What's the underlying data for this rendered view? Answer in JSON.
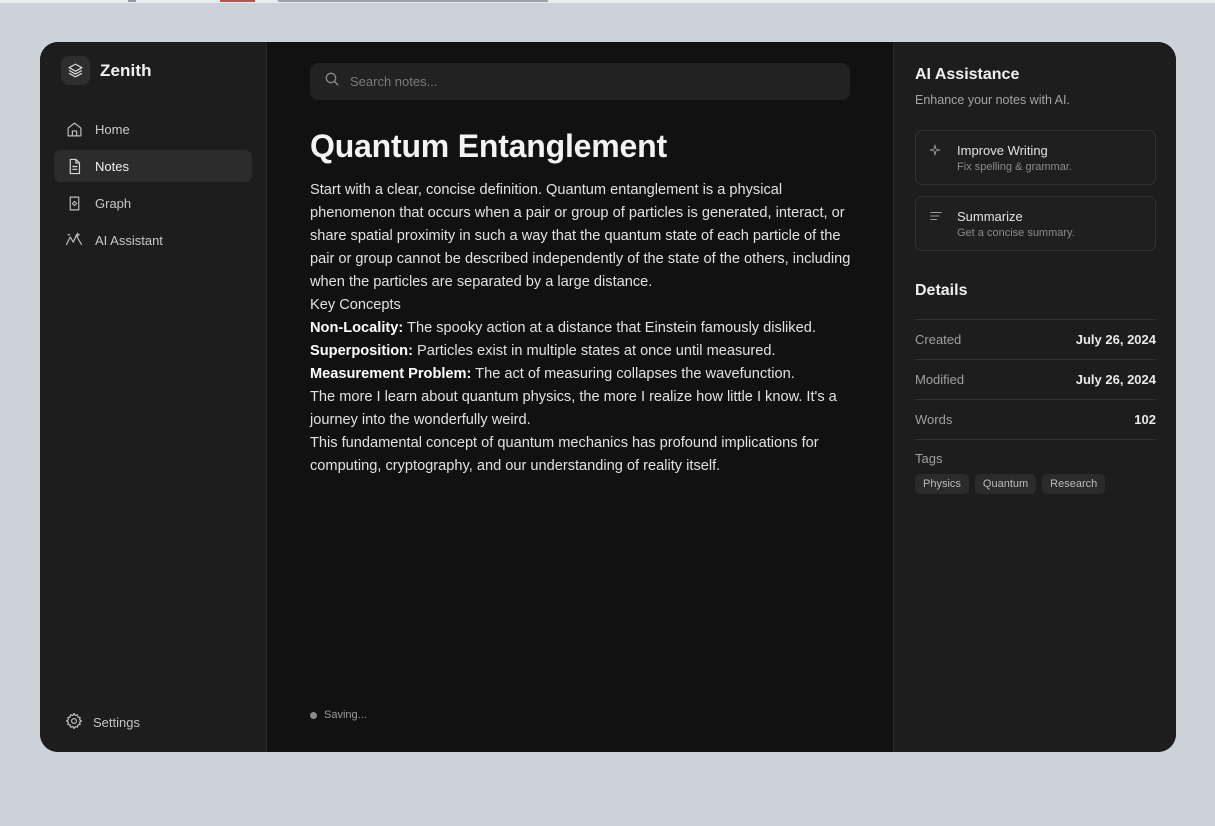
{
  "app": {
    "name": "Zenith"
  },
  "sidebar": {
    "items": [
      {
        "label": "Home",
        "icon": "home-icon"
      },
      {
        "label": "Notes",
        "icon": "document-icon",
        "active": true
      },
      {
        "label": "Graph",
        "icon": "graph-icon"
      },
      {
        "label": "AI Assistant",
        "icon": "ai-icon"
      }
    ],
    "settings_label": "Settings"
  },
  "search": {
    "placeholder": "Search notes..."
  },
  "note": {
    "title": "Quantum Entanglement",
    "intro": "Start with a clear, concise definition. Quantum entanglement is a physical phenomenon that occurs when a pair or group of particles is generated, interact, or share spatial proximity in such a way that the quantum state of each particle of the pair or group cannot be described independently of the state of the others, including when the particles are separated by a large distance.",
    "section_heading": "Key Concepts",
    "concepts": [
      {
        "term": "Non-Locality:",
        "text": " The spooky action at a distance that Einstein famously disliked."
      },
      {
        "term": "Superposition:",
        "text": " Particles exist in multiple states at once until measured."
      },
      {
        "term": "Measurement Problem:",
        "text": " The act of measuring collapses the wavefunction."
      }
    ],
    "reflection": "The more I learn about quantum physics, the more I realize how little I know. It's a journey into the wonderfully weird.",
    "conclusion": "This fundamental concept of quantum mechanics has profound implications for computing, cryptography, and our understanding of reality itself."
  },
  "status": {
    "text": "Saving..."
  },
  "ai_panel": {
    "title": "AI Assistance",
    "subtitle": "Enhance your notes with AI.",
    "actions": [
      {
        "title": "Improve Writing",
        "description": "Fix spelling & grammar.",
        "icon": "sparkle-icon"
      },
      {
        "title": "Summarize",
        "description": "Get a concise summary.",
        "icon": "summary-lines-icon"
      }
    ]
  },
  "details": {
    "title": "Details",
    "rows": [
      {
        "label": "Created",
        "value": "July 26, 2024"
      },
      {
        "label": "Modified",
        "value": "July 26, 2024"
      },
      {
        "label": "Words",
        "value": "102"
      }
    ],
    "tags_label": "Tags",
    "tags": [
      "Physics",
      "Quantum",
      "Research"
    ]
  },
  "colors": {
    "page_background": "#cbd2da",
    "window_background": "#111111",
    "sidebar_background": "#1d1d1d",
    "active_nav": "#2c2c2c"
  }
}
